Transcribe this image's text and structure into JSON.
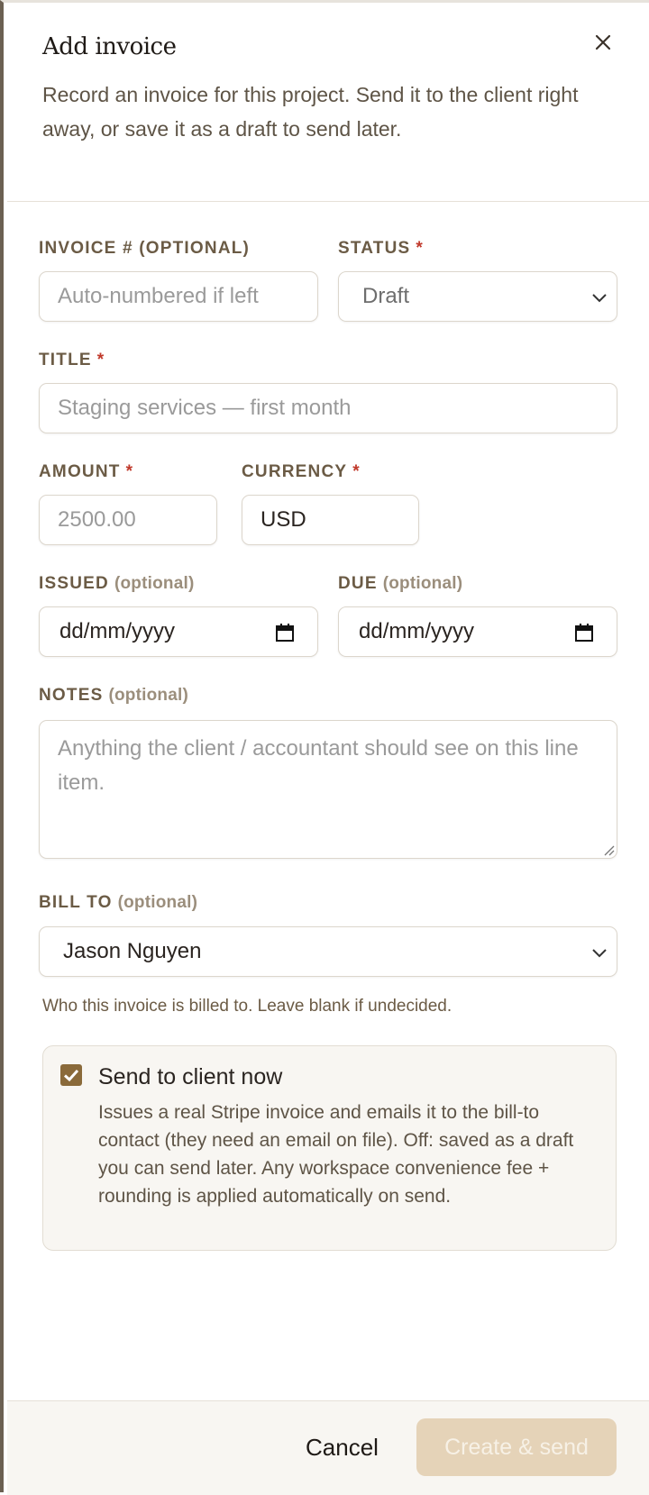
{
  "header": {
    "title": "Add invoice",
    "subtitle": "Record an invoice for this project. Send it to the client right away, or save it as a draft to send later."
  },
  "form": {
    "invoice_number": {
      "label": "INVOICE # (OPTIONAL)",
      "placeholder": "Auto-numbered if left"
    },
    "status": {
      "label": "STATUS",
      "required_mark": "*",
      "value": "Draft"
    },
    "title": {
      "label": "TITLE",
      "required_mark": "*",
      "placeholder": "Staging services — first month"
    },
    "amount": {
      "label": "AMOUNT",
      "required_mark": "*",
      "placeholder": "2500.00"
    },
    "currency": {
      "label": "CURRENCY",
      "required_mark": "*",
      "value": "USD"
    },
    "issued": {
      "label": "ISSUED",
      "optional": "(optional)",
      "placeholder": "dd/mm/yyyy"
    },
    "due": {
      "label": "DUE",
      "optional": "(optional)",
      "placeholder": "dd/mm/yyyy"
    },
    "notes": {
      "label": "NOTES",
      "optional": "(optional)",
      "placeholder": "Anything the client / accountant should see on this line item."
    },
    "bill_to": {
      "label": "BILL TO",
      "optional": "(optional)",
      "value": "Jason Nguyen",
      "help": "Who this invoice is billed to. Leave blank if undecided."
    }
  },
  "send_option": {
    "checked": true,
    "title": "Send to client now",
    "description": "Issues a real Stripe invoice and emails it to the bill-to contact (they need an email on file). Off: saved as a draft you can send later. Any workspace convenience fee + rounding is applied automatically on send."
  },
  "footer": {
    "cancel_label": "Cancel",
    "create_label": "Create & send"
  },
  "colors": {
    "accent": "#8a6a3a",
    "label": "#6b5b45",
    "required": "#c0392b",
    "primary_button_disabled": "#e5d3b8"
  }
}
